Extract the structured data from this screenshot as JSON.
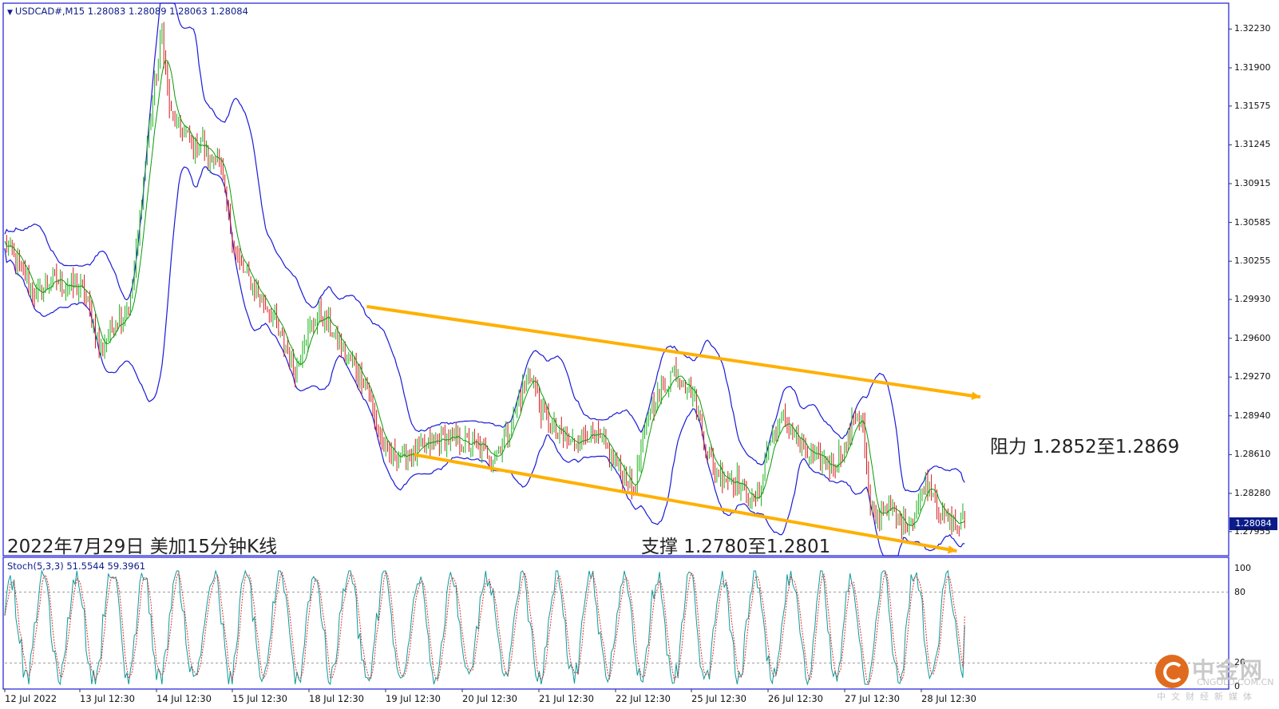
{
  "header": {
    "symbol_line": "USDCAD#,M15  1.28083 1.28089 1.28063 1.28084",
    "stoch_line": "Stoch(5,3,3) 51.5544 59.3961"
  },
  "annotations": {
    "title": "2022年7月29日 美加15分钟K线",
    "resistance": "阻力 1.2852至1.2869",
    "support": "支撑 1.2780至1.2801"
  },
  "current_price": "1.28084",
  "watermark": {
    "name": "中金网",
    "domain": "CNGOLD.COM.CN",
    "tagline": "中文财经新媒体"
  },
  "colors": {
    "frame": "#1a1ad8",
    "bollinger": "#1a1ad8",
    "candle_up": "#1bb11b",
    "candle_down": "#d41b1b",
    "channel": "#ffb000",
    "stoch_main": "#0f9a9a",
    "stoch_signal": "#e03030"
  },
  "chart_data": [
    {
      "type": "candlestick",
      "symbol": "USDCAD#",
      "timeframe": "M15",
      "y_axis_ticks": [
        "1.32230",
        "1.31900",
        "1.31575",
        "1.31245",
        "1.30915",
        "1.30585",
        "1.30255",
        "1.29930",
        "1.29600",
        "1.29270",
        "1.28940",
        "1.28610",
        "1.28280",
        "1.27955"
      ],
      "ylim": [
        1.2775,
        1.3245
      ],
      "x_axis_ticks": [
        "12 Jul 2022",
        "13 Jul 12:30",
        "14 Jul 12:30",
        "15 Jul 12:30",
        "18 Jul 12:30",
        "19 Jul 12:30",
        "20 Jul 12:30",
        "21 Jul 12:30",
        "22 Jul 12:30",
        "25 Jul 12:30",
        "26 Jul 12:30",
        "27 Jul 12:30",
        "28 Jul 12:30"
      ],
      "price_path": [
        [
          0,
          1.304
        ],
        [
          2,
          1.302
        ],
        [
          4,
          1.2995
        ],
        [
          6,
          1.301
        ],
        [
          8,
          1.3005
        ],
        [
          10,
          1.3
        ],
        [
          11,
          1.298
        ],
        [
          12,
          1.295
        ],
        [
          13,
          1.296
        ],
        [
          14,
          1.2975
        ],
        [
          15,
          1.298
        ],
        [
          16,
          1.299
        ],
        [
          17,
          1.305
        ],
        [
          18,
          1.312
        ],
        [
          19,
          1.317
        ],
        [
          20,
          1.322
        ],
        [
          21,
          1.315
        ],
        [
          22,
          1.314
        ],
        [
          23,
          1.3135
        ],
        [
          24,
          1.312
        ],
        [
          25,
          1.313
        ],
        [
          26,
          1.311
        ],
        [
          27,
          1.312
        ],
        [
          28,
          1.308
        ],
        [
          29,
          1.304
        ],
        [
          30,
          1.302
        ],
        [
          31,
          1.301
        ],
        [
          32,
          1.3
        ],
        [
          33,
          1.299
        ],
        [
          34,
          1.298
        ],
        [
          35,
          1.296
        ],
        [
          36,
          1.295
        ],
        [
          37,
          1.293
        ],
        [
          38,
          1.296
        ],
        [
          39,
          1.297
        ],
        [
          40,
          1.298
        ],
        [
          41,
          1.2975
        ],
        [
          42,
          1.296
        ],
        [
          43,
          1.295
        ],
        [
          44,
          1.294
        ],
        [
          45,
          1.293
        ],
        [
          46,
          1.292
        ],
        [
          47,
          1.289
        ],
        [
          48,
          1.287
        ],
        [
          49,
          1.286
        ],
        [
          50,
          1.286
        ],
        [
          52,
          1.2862
        ],
        [
          54,
          1.287
        ],
        [
          56,
          1.2875
        ],
        [
          58,
          1.2872
        ],
        [
          60,
          1.2868
        ],
        [
          62,
          1.286
        ],
        [
          64,
          1.288
        ],
        [
          66,
          1.292
        ],
        [
          67,
          1.293
        ],
        [
          68,
          1.29
        ],
        [
          70,
          1.288
        ],
        [
          72,
          1.287
        ],
        [
          74,
          1.288
        ],
        [
          76,
          1.287
        ],
        [
          78,
          1.285
        ],
        [
          80,
          1.283
        ],
        [
          81,
          1.287
        ],
        [
          82,
          1.29
        ],
        [
          84,
          1.292
        ],
        [
          85,
          1.2935
        ],
        [
          86,
          1.2925
        ],
        [
          87,
          1.292
        ],
        [
          88,
          1.29
        ],
        [
          89,
          1.287
        ],
        [
          90,
          1.285
        ],
        [
          91,
          1.2845
        ],
        [
          92,
          1.284
        ],
        [
          93,
          1.284
        ],
        [
          94,
          1.283
        ],
        [
          95,
          1.282
        ],
        [
          96,
          1.283
        ],
        [
          97,
          1.287
        ],
        [
          98,
          1.288
        ],
        [
          99,
          1.289
        ],
        [
          100,
          1.288
        ],
        [
          101,
          1.287
        ],
        [
          102,
          1.286
        ],
        [
          103,
          1.2858
        ],
        [
          104,
          1.2855
        ],
        [
          105,
          1.285
        ],
        [
          106,
          1.286
        ],
        [
          107,
          1.287
        ],
        [
          108,
          1.2895
        ],
        [
          109,
          1.289
        ],
        [
          110,
          1.281
        ],
        [
          111,
          1.2808
        ],
        [
          112,
          1.282
        ],
        [
          113,
          1.281
        ],
        [
          114,
          1.28
        ],
        [
          115,
          1.2805
        ],
        [
          116,
          1.2815
        ],
        [
          117,
          1.284
        ],
        [
          118,
          1.283
        ],
        [
          119,
          1.281
        ],
        [
          120,
          1.2805
        ],
        [
          121,
          1.28
        ],
        [
          122,
          1.2808
        ]
      ],
      "indicators": [
        "Bollinger Bands"
      ],
      "trend_lines": [
        {
          "name": "upper channel",
          "from": [
            46,
            1.2987
          ],
          "to": [
            124,
            1.291
          ]
        },
        {
          "name": "lower channel",
          "from": [
            52,
            1.2861
          ],
          "to": [
            121,
            1.2779
          ]
        }
      ]
    },
    {
      "type": "line",
      "indicator": "Stoch(5,3,3)",
      "values_current": {
        "main": 51.5544,
        "signal": 59.3961
      },
      "y_axis_ticks": [
        "100",
        "80",
        "20",
        "0"
      ],
      "ylim": [
        0,
        100
      ],
      "levels": [
        80,
        20
      ]
    }
  ]
}
